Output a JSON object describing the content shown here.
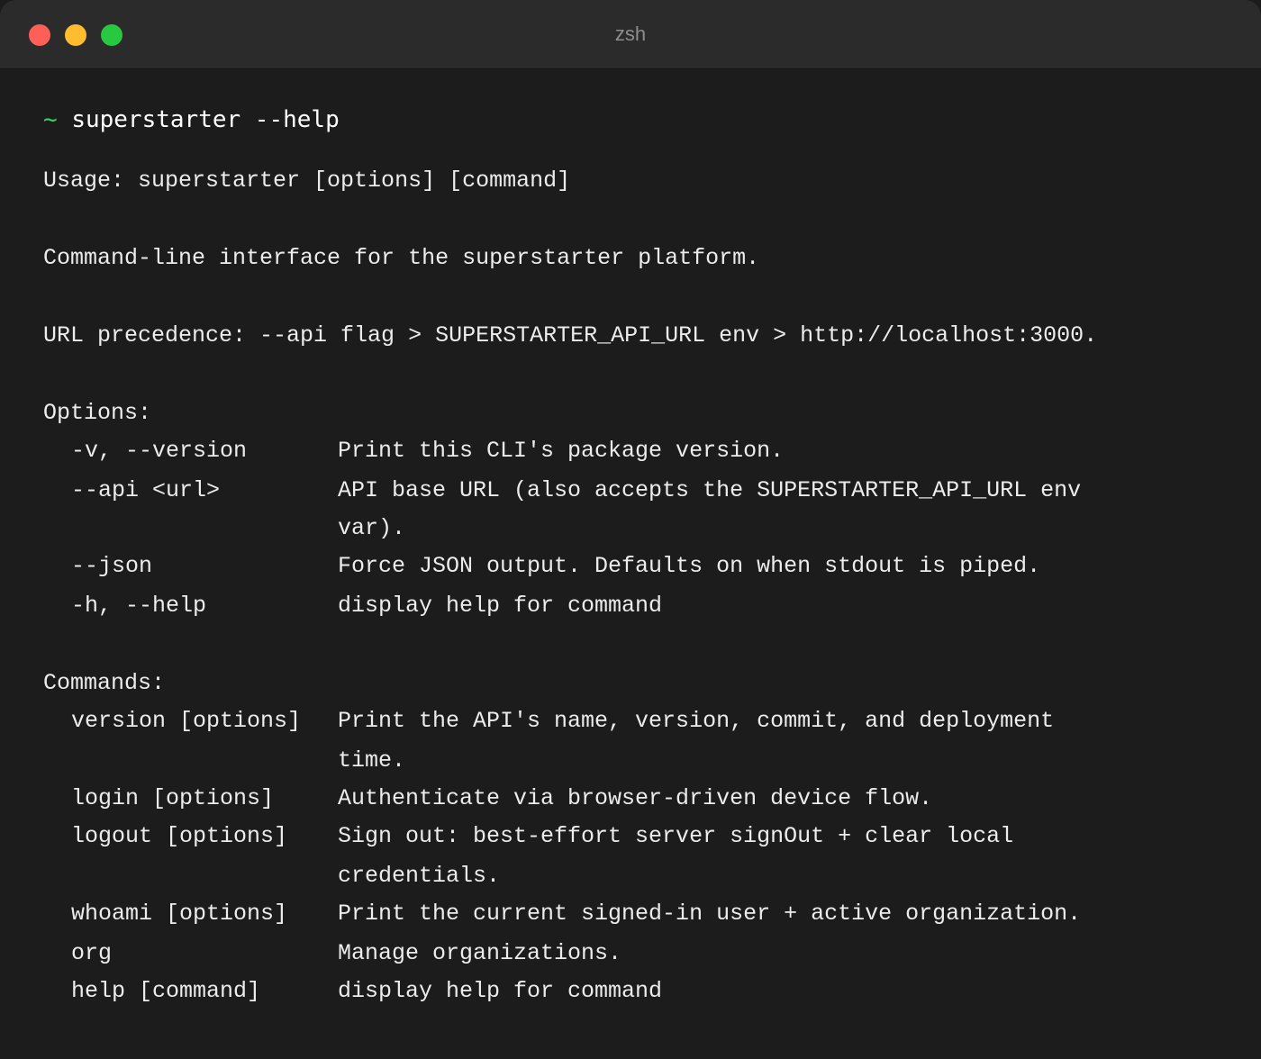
{
  "window": {
    "title": "zsh"
  },
  "prompt": {
    "symbol": "~",
    "command": "superstarter --help"
  },
  "output": {
    "usage": "Usage: superstarter [options] [command]",
    "description": "Command-line interface for the superstarter platform.",
    "url_precedence": "URL precedence: --api flag > SUPERSTARTER_API_URL env > http://localhost:3000.",
    "options_header": "Options:",
    "options": [
      {
        "flag": "-v, --version",
        "desc": [
          "Print this CLI's package version."
        ]
      },
      {
        "flag": "--api <url>",
        "desc": [
          "API base URL (also accepts the SUPERSTARTER_API_URL env",
          "var)."
        ]
      },
      {
        "flag": "--json",
        "desc": [
          "Force JSON output. Defaults on when stdout is piped."
        ]
      },
      {
        "flag": "-h, --help",
        "desc": [
          "display help for command"
        ]
      }
    ],
    "commands_header": "Commands:",
    "commands": [
      {
        "name": "version [options]",
        "desc": [
          "Print the API's name, version, commit, and deployment",
          "time."
        ]
      },
      {
        "name": "login [options]",
        "desc": [
          "Authenticate via browser-driven device flow."
        ]
      },
      {
        "name": "logout [options]",
        "desc": [
          "Sign out: best-effort server signOut + clear local",
          "credentials."
        ]
      },
      {
        "name": "whoami [options]",
        "desc": [
          "Print the current signed-in user + active organization."
        ]
      },
      {
        "name": "org",
        "desc": [
          "Manage organizations."
        ]
      },
      {
        "name": "help [command]",
        "desc": [
          "display help for command"
        ]
      }
    ]
  }
}
